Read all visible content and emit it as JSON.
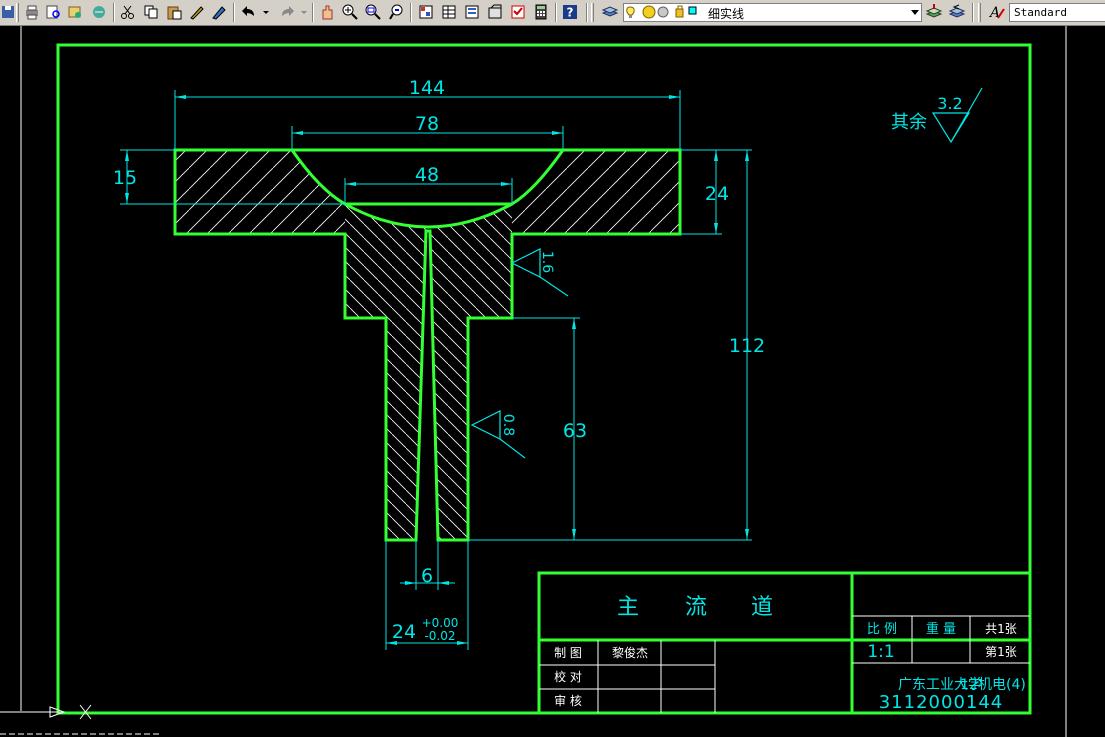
{
  "toolbar": {
    "layer_name": "细实线",
    "text_style": "Standard"
  },
  "drawing": {
    "roughness_other_label": "其余",
    "roughness_other_value": "3.2",
    "roughness_upper": "1.6",
    "roughness_lower": "0.8",
    "dimensions": {
      "overall_width": "144",
      "countersink_width": "78",
      "inner_width": "48",
      "flange_thickness": "15",
      "head_thickness": "24",
      "total_height": "112",
      "stem_height": "63",
      "hole_diameter": "6",
      "stem_diameter": "24",
      "tol_upper": "+0.00",
      "tol_lower": "-0.02"
    }
  },
  "title_block": {
    "part_name": [
      "主",
      "流",
      "道"
    ],
    "scale_label": "比 例",
    "weight_label": "重 量",
    "sheets_total": "共1张",
    "scale_value": "1:1",
    "sheet_number": "第1张",
    "drawn_label": "制 图",
    "drawn_by": "黎俊杰",
    "checked_label": "校 对",
    "approved_label": "审 核",
    "school": "广东工业大学",
    "class_name": "12机电(4)",
    "student_id": "3112000144"
  },
  "colors": {
    "outline": "#33ff33",
    "dimension": "#00e5e5",
    "hatch": "#ffffff",
    "background": "#000000",
    "text_white": "#ffffff"
  }
}
